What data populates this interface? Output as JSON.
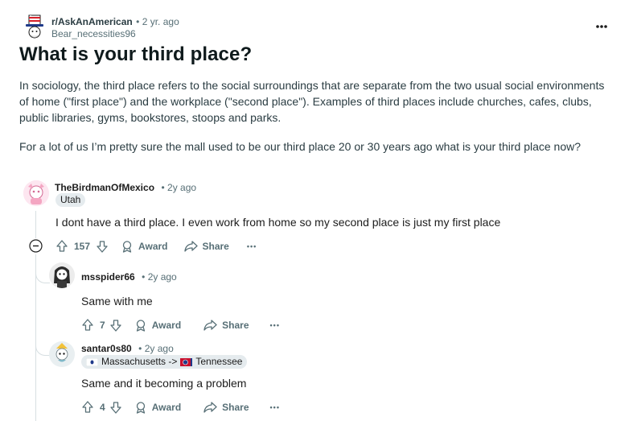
{
  "post": {
    "subreddit": "r/AskAnAmerican",
    "time": "• 2 yr. ago",
    "author": "Bear_necessities96",
    "title": "What is your third place?",
    "paragraph1": "In sociology, the third place refers to the social surroundings that are separate from the two usual social environments of home (\"first place\") and the workplace (\"second place\"). Examples of third places include churches, cafes, clubs, public libraries, gyms, bookstores, stoops and parks.",
    "paragraph2": "For a lot of us I’m pretty sure the mall used to be our third place 20 or 30 years ago what is your third place now?",
    "more_label": "•••"
  },
  "comments": [
    {
      "username": "TheBirdmanOfMexico",
      "time": "• 2y ago",
      "flair": "Utah",
      "text": "I dont have a third place. I even work from home so my second place is just my first place",
      "votes": "157",
      "award": "Award",
      "share": "Share",
      "more": "•••"
    },
    {
      "username": "msspider66",
      "time": "• 2y ago",
      "text": "Same with me",
      "votes": "7",
      "award": "Award",
      "share": "Share",
      "more": "•••"
    },
    {
      "username": "santar0s80",
      "time": "• 2y ago",
      "flair": "Massachusetts -> ",
      "flair_tail": "Tennessee",
      "text": "Same and it becoming a problem",
      "votes": "4",
      "award": "Award",
      "share": "Share",
      "more": "•••"
    }
  ],
  "colors": {
    "text_primary": "#1c1c1c",
    "text_muted": "#576f76",
    "thread_line": "#d7dfe2",
    "flair_bg": "#e5ebee"
  }
}
